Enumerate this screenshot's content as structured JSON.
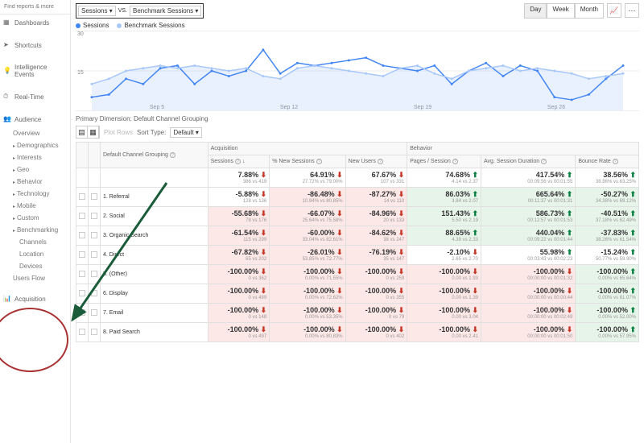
{
  "search": {
    "placeholder": "Find reports & more"
  },
  "nav": {
    "dashboards": "Dashboards",
    "shortcuts": "Shortcuts",
    "intel": "Intelligence Events",
    "realtime": "Real-Time",
    "audience": "Audience",
    "acquisition": "Acquisition"
  },
  "audience_sub": {
    "overview": "Overview",
    "demographics": "Demographics",
    "interests": "Interests",
    "geo": "Geo",
    "behavior": "Behavior",
    "technology": "Technology",
    "mobile": "Mobile",
    "custom": "Custom",
    "benchmarking": "Benchmarking",
    "channels": "Channels",
    "location": "Location",
    "devices": "Devices",
    "users_flow": "Users Flow"
  },
  "selectors": {
    "sessions": "Sessions",
    "vs": "VS.",
    "benchmark": "Benchmark Sessions"
  },
  "time_buttons": {
    "day": "Day",
    "week": "Week",
    "month": "Month"
  },
  "legend": {
    "s1": "Sessions",
    "s2": "Benchmark Sessions"
  },
  "chart_axis": {
    "y_max": "30",
    "y_mid": "15",
    "x1": "Sep 5",
    "x2": "Sep 12",
    "x3": "Sep 19",
    "x4": "Sep 26"
  },
  "dimension": "Primary Dimension: Default Channel Grouping",
  "table_controls": {
    "plot_rows": "Plot Rows",
    "sort_type": "Sort Type:",
    "default": "Default"
  },
  "headers": {
    "grouping": "Default Channel Grouping",
    "acquisition": "Acquisition",
    "behavior": "Behavior",
    "sessions": "Sessions",
    "new_sessions": "% New Sessions",
    "new_users": "New Users",
    "pages_session": "Pages / Session",
    "avg_duration": "Avg. Session Duration",
    "bounce": "Bounce Rate"
  },
  "totals": {
    "sessions": {
      "v": "7.88%",
      "s": "386 vs 419",
      "d": "down"
    },
    "new_sessions": {
      "v": "64.91%",
      "s": "27.72% vs 79.00%",
      "d": "down"
    },
    "new_users": {
      "v": "67.67%",
      "s": "107 vs 331",
      "d": "down"
    },
    "pages": {
      "v": "74.68%",
      "s": "4.14 vs 2.37",
      "d": "up"
    },
    "duration": {
      "v": "417.54%",
      "s": "00:09:56 vs 00:01:55",
      "d": "up"
    },
    "bounce": {
      "v": "38.56%",
      "s": "38.86% vs 63.25%",
      "d": "up"
    }
  },
  "rows": [
    {
      "n": "1.",
      "name": "Referral",
      "sessions": {
        "v": "-5.88%",
        "s": "128 vs 136",
        "d": "down",
        "c": ""
      },
      "new_s": {
        "v": "-86.48%",
        "s": "10.94% vs 80.85%",
        "d": "down",
        "c": "red-bg"
      },
      "new_u": {
        "v": "-87.27%",
        "s": "14 vs 110",
        "d": "down",
        "c": "red-bg"
      },
      "pages": {
        "v": "86.03%",
        "s": "3.84 vs 2.07",
        "d": "up",
        "c": "green-bg"
      },
      "dur": {
        "v": "665.64%",
        "s": "00:11:37 vs 00:01:31",
        "d": "up",
        "c": "green-bg"
      },
      "bounce": {
        "v": "-50.27%",
        "s": "34.38% vs 69.12%",
        "d": "up",
        "c": "green-bg"
      }
    },
    {
      "n": "2.",
      "name": "Social",
      "sessions": {
        "v": "-55.68%",
        "s": "78 vs 176",
        "d": "down",
        "c": "red-bg"
      },
      "new_s": {
        "v": "-66.07%",
        "s": "25.64% vs 75.58%",
        "d": "down",
        "c": "red-bg"
      },
      "new_u": {
        "v": "-84.96%",
        "s": "20 vs 133",
        "d": "down",
        "c": "red-bg"
      },
      "pages": {
        "v": "151.43%",
        "s": "5.50 vs 2.19",
        "d": "up",
        "c": "green-bg"
      },
      "dur": {
        "v": "586.73%",
        "s": "00:12:57 vs 00:01:53",
        "d": "up",
        "c": "green-bg"
      },
      "bounce": {
        "v": "-40.51%",
        "s": "37.18% vs 62.49%",
        "d": "up",
        "c": "green-bg"
      }
    },
    {
      "n": "3.",
      "name": "Organic Search",
      "sessions": {
        "v": "-61.54%",
        "s": "115 vs 299",
        "d": "down",
        "c": "red-bg"
      },
      "new_s": {
        "v": "-60.00%",
        "s": "33.04% vs 82.61%",
        "d": "down",
        "c": "red-bg"
      },
      "new_u": {
        "v": "-84.62%",
        "s": "38 vs 247",
        "d": "down",
        "c": "red-bg"
      },
      "pages": {
        "v": "88.65%",
        "s": "4.39 vs 2.33",
        "d": "up",
        "c": "green-bg"
      },
      "dur": {
        "v": "440.04%",
        "s": "00:09:22 vs 00:01:44",
        "d": "up",
        "c": "green-bg"
      },
      "bounce": {
        "v": "-37.83%",
        "s": "38.26% vs 61.54%",
        "d": "up",
        "c": "green-bg"
      }
    },
    {
      "n": "4.",
      "name": "Direct",
      "sessions": {
        "v": "-67.82%",
        "s": "65 vs 202",
        "d": "down",
        "c": "red-bg"
      },
      "new_s": {
        "v": "-26.01%",
        "s": "53.85% vs 72.77%",
        "d": "down",
        "c": "red-bg"
      },
      "new_u": {
        "v": "-76.19%",
        "s": "35 vs 147",
        "d": "down",
        "c": "red-bg"
      },
      "pages": {
        "v": "-2.10%",
        "s": "2.65 vs 2.70",
        "d": "down",
        "c": ""
      },
      "dur": {
        "v": "55.98%",
        "s": "00:03:43 vs 00:02:23",
        "d": "up",
        "c": ""
      },
      "bounce": {
        "v": "-15.24%",
        "s": "50.77% vs 59.90%",
        "d": "up",
        "c": ""
      }
    },
    {
      "n": "5.",
      "name": "(Other)",
      "sessions": {
        "v": "-100.00%",
        "s": "0 vs 362",
        "d": "down",
        "c": "red-bg"
      },
      "new_s": {
        "v": "-100.00%",
        "s": "0.00% vs 71.55%",
        "d": "down",
        "c": "red-bg"
      },
      "new_u": {
        "v": "-100.00%",
        "s": "0 vs 259",
        "d": "down",
        "c": "red-bg"
      },
      "pages": {
        "v": "-100.00%",
        "s": "0.00 vs 1.93",
        "d": "down",
        "c": "red-bg"
      },
      "dur": {
        "v": "-100.00%",
        "s": "00:00:00 vs 00:01:32",
        "d": "down",
        "c": "red-bg"
      },
      "bounce": {
        "v": "-100.00%",
        "s": "0.00% vs 65.64%",
        "d": "up",
        "c": "green-bg"
      }
    },
    {
      "n": "6.",
      "name": "Display",
      "sessions": {
        "v": "-100.00%",
        "s": "0 vs 489",
        "d": "down",
        "c": "red-bg"
      },
      "new_s": {
        "v": "-100.00%",
        "s": "0.00% vs 72.62%",
        "d": "down",
        "c": "red-bg"
      },
      "new_u": {
        "v": "-100.00%",
        "s": "0 vs 355",
        "d": "down",
        "c": "red-bg"
      },
      "pages": {
        "v": "-100.00%",
        "s": "0.00 vs 1.39",
        "d": "down",
        "c": "red-bg"
      },
      "dur": {
        "v": "-100.00%",
        "s": "00:00:00 vs 00:00:44",
        "d": "down",
        "c": "red-bg"
      },
      "bounce": {
        "v": "-100.00%",
        "s": "0.00% vs 81.07%",
        "d": "up",
        "c": "green-bg"
      }
    },
    {
      "n": "7.",
      "name": "Email",
      "sessions": {
        "v": "-100.00%",
        "s": "0 vs 148",
        "d": "down",
        "c": "red-bg"
      },
      "new_s": {
        "v": "-100.00%",
        "s": "0.00% vs 53.35%",
        "d": "down",
        "c": "red-bg"
      },
      "new_u": {
        "v": "-100.00%",
        "s": "0 vs 79",
        "d": "down",
        "c": "red-bg"
      },
      "pages": {
        "v": "-100.00%",
        "s": "0.00 vs 3.04",
        "d": "down",
        "c": "red-bg"
      },
      "dur": {
        "v": "-100.00%",
        "s": "00:00:00 vs 00:02:49",
        "d": "down",
        "c": "red-bg"
      },
      "bounce": {
        "v": "-100.00%",
        "s": "0.00% vs 52.00%",
        "d": "up",
        "c": "green-bg"
      }
    },
    {
      "n": "8.",
      "name": "Paid Search",
      "sessions": {
        "v": "-100.00%",
        "s": "0 vs 497",
        "d": "down",
        "c": "red-bg"
      },
      "new_s": {
        "v": "-100.00%",
        "s": "0.00% vs 80.83%",
        "d": "down",
        "c": "red-bg"
      },
      "new_u": {
        "v": "-100.00%",
        "s": "0 vs 402",
        "d": "down",
        "c": "red-bg"
      },
      "pages": {
        "v": "-100.00%",
        "s": "0.00 vs 2.41",
        "d": "down",
        "c": "red-bg"
      },
      "dur": {
        "v": "-100.00%",
        "s": "00:00:00 vs 00:01:50",
        "d": "down",
        "c": "red-bg"
      },
      "bounce": {
        "v": "-100.00%",
        "s": "0.00% vs 57.95%",
        "d": "up",
        "c": "green-bg"
      }
    }
  ],
  "chart_data": {
    "type": "line",
    "title": "",
    "xlabel": "",
    "ylabel": "",
    "ylim": [
      0,
      30
    ],
    "x_ticks": [
      "Sep 5",
      "Sep 12",
      "Sep 19",
      "Sep 26"
    ],
    "series": [
      {
        "name": "Sessions",
        "color": "#4285f4",
        "values": [
          5,
          6,
          12,
          10,
          16,
          17,
          10,
          15,
          13,
          15,
          23,
          14,
          18,
          17,
          18,
          19,
          20,
          17,
          16,
          15,
          17,
          10,
          15,
          18,
          13,
          17,
          15,
          5,
          4,
          6,
          12,
          17
        ]
      },
      {
        "name": "Benchmark Sessions",
        "color": "#a8c7fa",
        "values": [
          10,
          12,
          15,
          16,
          17,
          16,
          17,
          16,
          15,
          16,
          13,
          12,
          16,
          17,
          16,
          15,
          14,
          13,
          16,
          17,
          14,
          12,
          15,
          16,
          17,
          15,
          16,
          15,
          14,
          12,
          13,
          14
        ]
      }
    ]
  }
}
